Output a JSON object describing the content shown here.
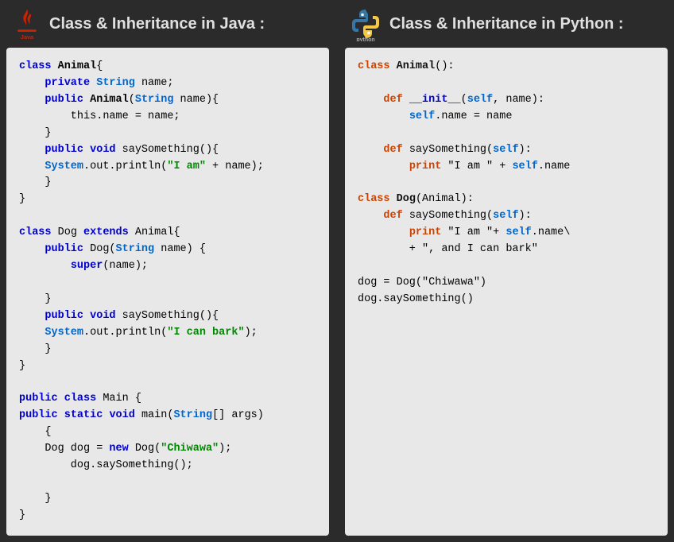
{
  "header": {
    "java_title": "Class & Inheritance in Java :",
    "python_title": "Class & Inheritance in Python :"
  },
  "java_code": {
    "lines": [
      "class Animal{",
      "    private String name;",
      "    public Animal(String name){",
      "        this.name = name;",
      "    }",
      "    public void saySomething(){",
      "    System.out.println(\"I am\" + name);",
      "    }",
      "}",
      "",
      "class Dog extends Animal{",
      "    public Dog(String name) {",
      "        super(name);",
      "",
      "    }",
      "    public void saySomething(){",
      "    System.out.println(\"I can bark\");",
      "    }",
      "}",
      "",
      "public class Main {",
      "public static void main(String[] args)",
      "    {",
      "    Dog dog = new Dog(\"Chiwawa\");",
      "        dog.saySomething();",
      "",
      "    }",
      "}"
    ]
  },
  "python_code": {
    "lines": [
      "class Animal():",
      "",
      "    def __init__(self, name):",
      "        self.name = name",
      "",
      "    def saySomething(self):",
      "        print \"I am \" + self.name",
      "",
      "class Dog(Animal):",
      "    def saySomething(self):",
      "        print \"I am \"+ self.name\\",
      "        + \", and I can bark\"",
      "",
      "dog = Dog(\"Chiwawa\")",
      "dog.saySomething()"
    ]
  }
}
